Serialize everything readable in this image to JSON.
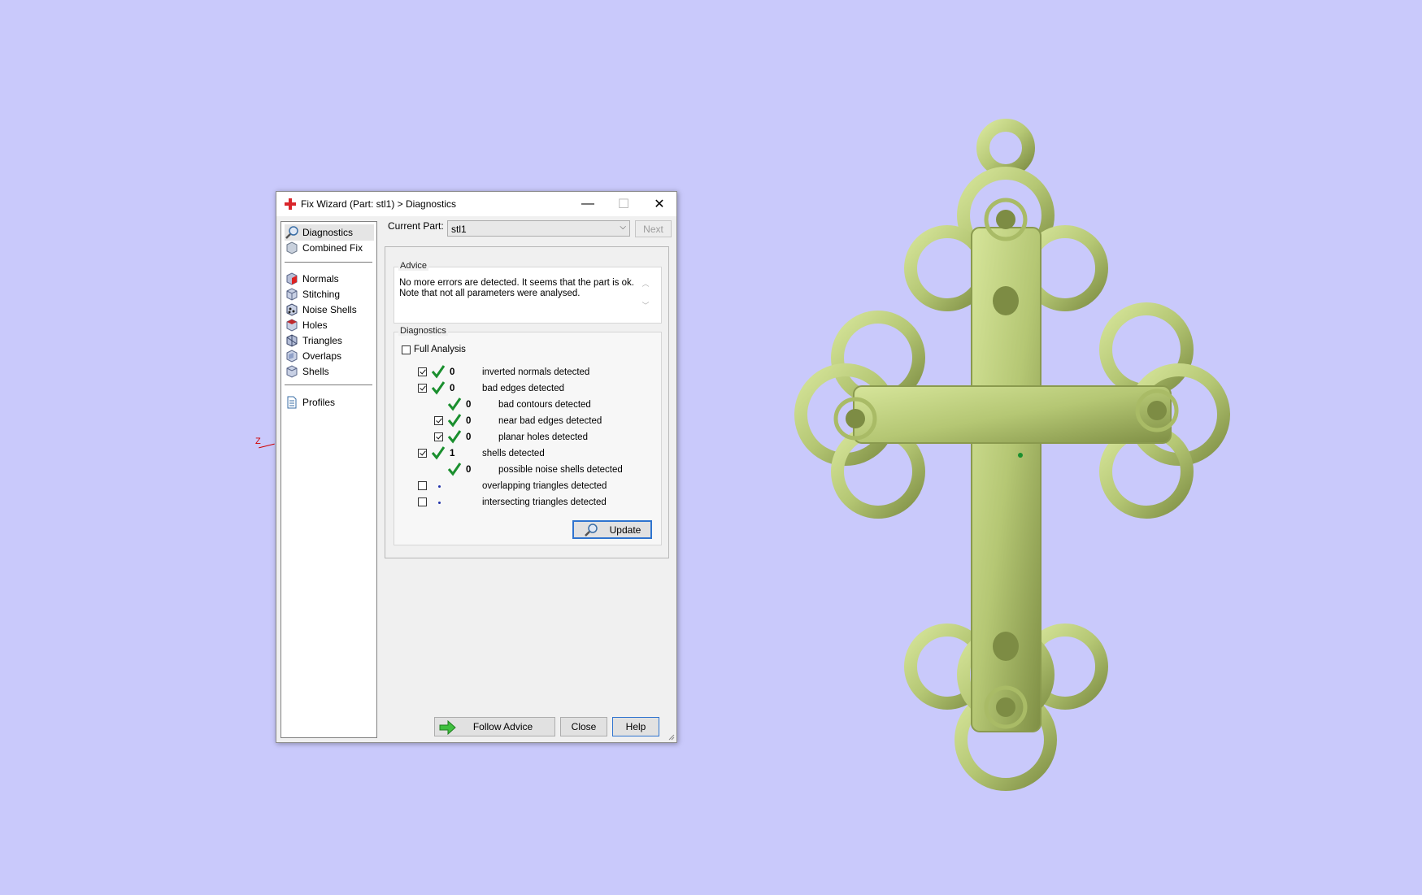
{
  "dialog": {
    "title": "Fix Wizard (Part: stl1) > Diagnostics",
    "title_icon": "red-cross-icon",
    "controls": {
      "minimize": "—",
      "maximize": "☐",
      "close": "✕"
    }
  },
  "nav": {
    "items": [
      {
        "label": "Diagnostics",
        "icon": "magnifier-icon",
        "selected": true
      },
      {
        "label": "Combined Fix",
        "icon": "cube-icon"
      },
      {
        "label": "Normals",
        "icon": "cube-red-icon"
      },
      {
        "label": "Stitching",
        "icon": "cube-stitch-icon"
      },
      {
        "label": "Noise Shells",
        "icon": "cube-noise-icon"
      },
      {
        "label": "Holes",
        "icon": "cube-hole-icon"
      },
      {
        "label": "Triangles",
        "icon": "cube-triangles-icon"
      },
      {
        "label": "Overlaps",
        "icon": "cube-overlap-icon"
      },
      {
        "label": "Shells",
        "icon": "cube-shells-icon"
      },
      {
        "label": "Profiles",
        "icon": "document-icon"
      }
    ]
  },
  "current_part": {
    "label": "Current Part:",
    "value": "stl1"
  },
  "next_label": "Next",
  "advice": {
    "title": "Advice",
    "line1": "No more errors are detected. It seems that the part is ok.",
    "line2": "Note that not all parameters were analysed."
  },
  "diagnostics": {
    "title": "Diagnostics",
    "full_analysis": "Full Analysis",
    "rows": [
      {
        "value": "0",
        "label": "inverted normals detected"
      },
      {
        "value": "0",
        "label": "bad edges detected"
      },
      {
        "value": "0",
        "label": "bad contours detected"
      },
      {
        "value": "0",
        "label": "near bad edges detected"
      },
      {
        "value": "0",
        "label": "planar holes detected"
      },
      {
        "value": "1",
        "label": "shells detected"
      },
      {
        "value": "0",
        "label": "possible noise shells detected"
      },
      {
        "value": "",
        "label": "overlapping triangles detected"
      },
      {
        "value": "",
        "label": "intersecting triangles detected"
      }
    ],
    "update_label": "Update"
  },
  "footer": {
    "follow_advice": "Follow Advice",
    "close": "Close",
    "help": "Help"
  },
  "axis_label": "Z",
  "colors": {
    "background": "#c9c9fb",
    "model": "#b8c97a",
    "check": "#1a8f2e",
    "accent": "#2f74cf"
  }
}
